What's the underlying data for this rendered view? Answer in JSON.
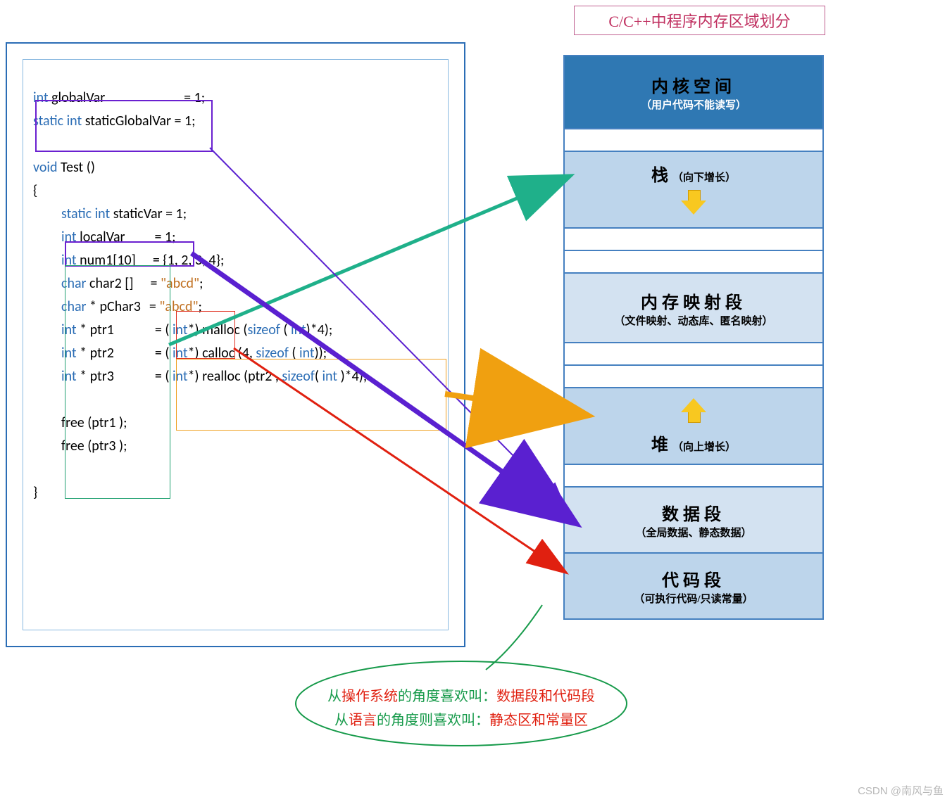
{
  "title": "C/C++中程序内存区域划分",
  "code": {
    "l1a": "int",
    "l1b": " globalVar",
    "l1c": "= 1;",
    "l2a": "static int",
    "l2b": " staticGlobalVar ",
    "l2c": "= 1;",
    "l3a": "void",
    "l3b": " Test ()",
    "l4": "{",
    "l5a": "static int",
    "l5b": " staticVar ",
    "l5c": "= 1;",
    "l6a": "int",
    "l6b": " localVar",
    "l6c": "= 1;",
    "l7a": "int",
    "l7b": " num1[10]",
    "l7c": "= {1, 2, 3, 4};",
    "l8a": "char",
    "l8b": " char2 []",
    "l8c": "= ",
    "l8d": "\"abcd\"",
    "l8e": ";",
    "l9a": "char",
    "l9b": " * pChar3",
    "l9c": "= ",
    "l9d": "\"abcd\"",
    "l9e": ";",
    "l10a": "int",
    "l10b": " * ptr1",
    "l10c": "= ( ",
    "l10d": "int",
    "l10e": "*) malloc (",
    "l10f": "sizeof",
    "l10g": " ( ",
    "l10h": "int",
    "l10i": ")*4);",
    "l11a": "int",
    "l11b": " * ptr2",
    "l11c": "= ( ",
    "l11d": "int",
    "l11e": "*) calloc (4, ",
    "l11f": "sizeof",
    "l11g": " ( ",
    "l11h": "int",
    "l11i": "));",
    "l12a": "int",
    "l12b": " * ptr3",
    "l12c": "= ( ",
    "l12d": "int",
    "l12e": "*) realloc (ptr2 , ",
    "l12f": "sizeof",
    "l12g": "( ",
    "l12h": "int",
    "l12i": " )*4);",
    "l13": "free (ptr1 );",
    "l14": "free (ptr3 );",
    "l15": "}"
  },
  "memory": {
    "kernel": {
      "title": "内核空间",
      "sub": "（用户代码不能读写）"
    },
    "stack": {
      "title": "栈",
      "sub": "（向下增长）"
    },
    "mmap": {
      "title": "内存映射段",
      "sub": "（文件映射、动态库、匿名映射）"
    },
    "heap": {
      "title": "堆",
      "sub": "（向上增长）"
    },
    "dataseg": {
      "title": "数据段",
      "sub": "（全局数据、静态数据）"
    },
    "codeseg": {
      "title": "代码段",
      "sub": "（可执行代码/只读常量）"
    }
  },
  "callout": {
    "p1a": "从",
    "p1b": "操作系统",
    "p1c": "的角度喜欢叫：",
    "p1d": "数据段和",
    "p1e": "代码段",
    "p2a": "从",
    "p2b": "语言",
    "p2c": "的角度则喜欢叫：",
    "p2d": "静态区和常量区"
  },
  "watermark": "CSDN @南风与鱼"
}
